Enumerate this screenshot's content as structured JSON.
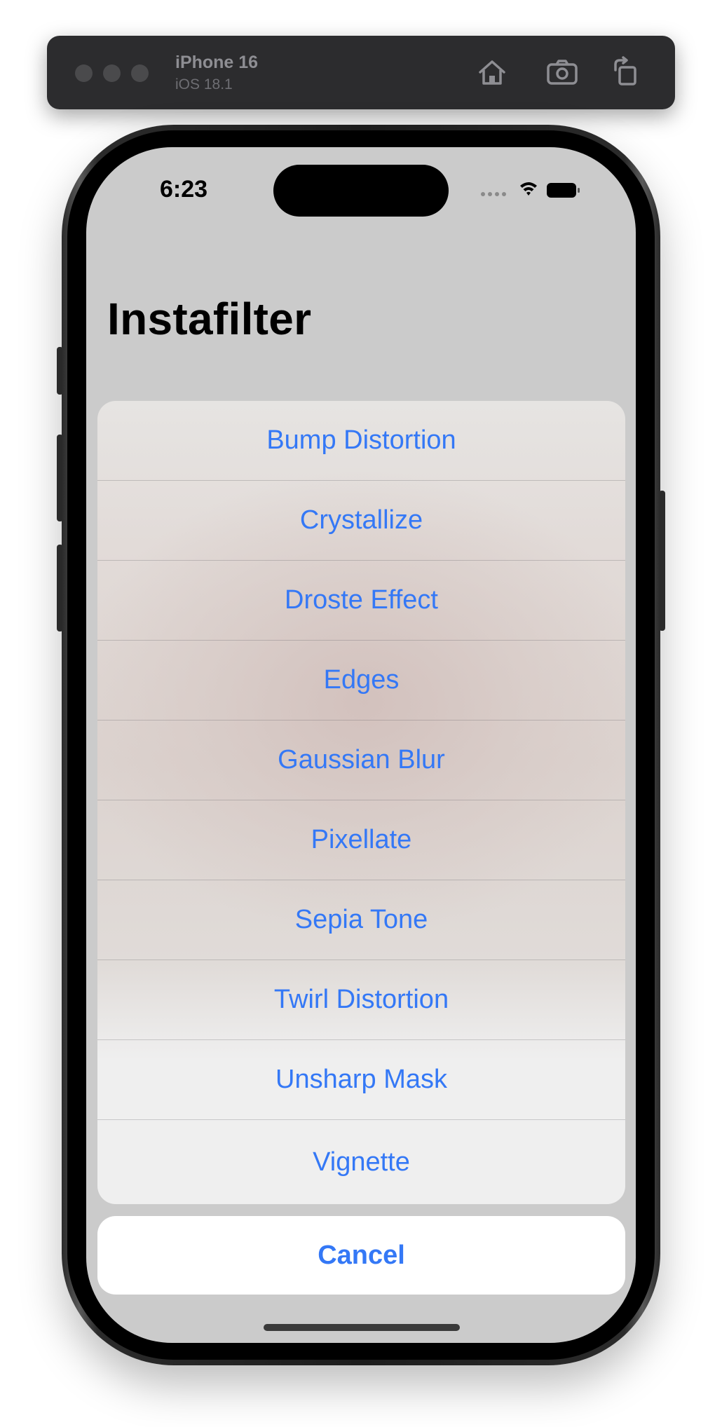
{
  "simulator": {
    "device_name": "iPhone 16",
    "os_version": "iOS 18.1",
    "buttons": {
      "home": "home-icon",
      "screenshot": "camera-icon",
      "rotate": "rotate-icon"
    }
  },
  "status_bar": {
    "time": "6:23",
    "icons": [
      "cellular-dots-icon",
      "wifi-icon",
      "battery-icon"
    ]
  },
  "nav": {
    "title": "Instafilter"
  },
  "action_sheet": {
    "options": [
      "Bump Distortion",
      "Crystallize",
      "Droste Effect",
      "Edges",
      "Gaussian Blur",
      "Pixellate",
      "Sepia Tone",
      "Twirl Distortion",
      "Unsharp Mask",
      "Vignette"
    ],
    "cancel_label": "Cancel"
  },
  "colors": {
    "tint": "#3478f6",
    "screen_background": "#cbcbcb"
  }
}
